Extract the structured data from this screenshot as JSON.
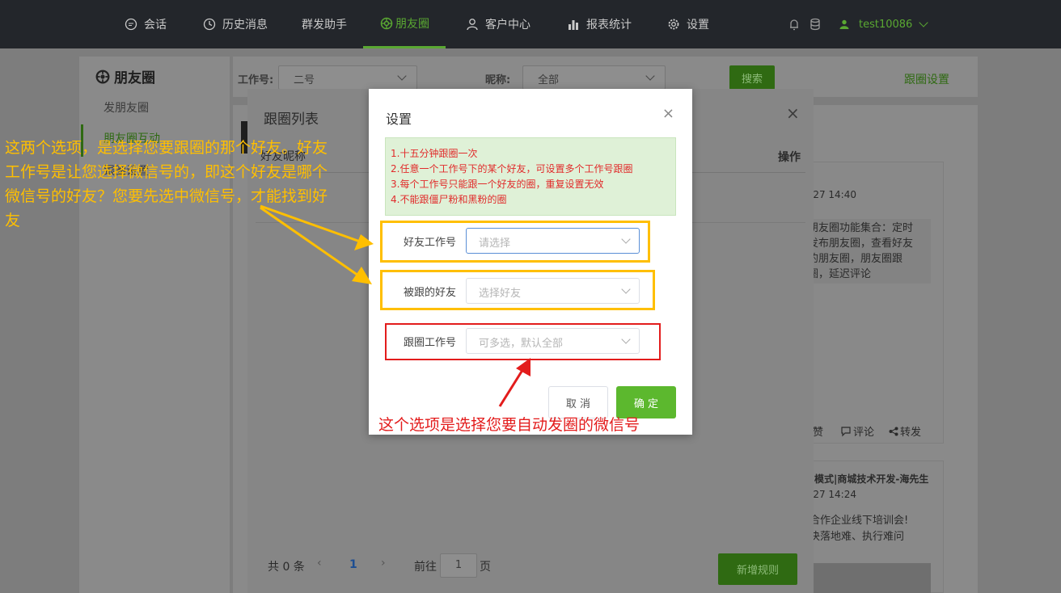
{
  "nav": {
    "tabs": [
      {
        "label": "会话",
        "icon": "chat-icon"
      },
      {
        "label": "历史消息",
        "icon": "clock-icon"
      },
      {
        "label": "群发助手",
        "icon": ""
      },
      {
        "label": "朋友圈",
        "icon": "aperture-icon"
      },
      {
        "label": "客户中心",
        "icon": "user-icon"
      },
      {
        "label": "报表统计",
        "icon": "bar-chart-icon"
      },
      {
        "label": "设置",
        "icon": "gear-icon"
      }
    ],
    "active_tab": "朋友圈",
    "username": "test10086"
  },
  "sidebar": {
    "title": "朋友圈",
    "items": [
      "发朋友圈",
      "朋友圈互动",
      "跟圈设置"
    ]
  },
  "filter": {
    "account_label": "工作号:",
    "account_value": "二号",
    "nickname_label": "昵称:",
    "nickname_value": "全部",
    "search_button": "搜索",
    "follow_settings_link": "跟圈设置"
  },
  "follow_list_dialog": {
    "title": "跟圈列表",
    "col_nickname": "好友昵称",
    "col_action": "操作",
    "pagination": {
      "total": "共 0 条",
      "current_page": "1",
      "goto_label": "前往",
      "goto_value": "1",
      "page_suffix": "页"
    },
    "add_rule_button": "新增规则"
  },
  "posts": [
    {
      "time": "-27 14:40",
      "lines": [
        "朋友圈功能集合：定时",
        "发布朋友圈，查看好友",
        "的朋友圈，朋友圈跟",
        "圈，延迟评论"
      ],
      "actions": [
        "赞",
        "评论",
        "转发"
      ]
    },
    {
      "author": "模式|商城技术开发-海先生",
      "time": "-27 14:24",
      "lines": [
        "合作企业线下培训会!",
        "决落地难、执行难问"
      ]
    }
  ],
  "settings_modal": {
    "title": "设置",
    "notice": [
      "1.十五分钟跟圈一次",
      "2.任意一个工作号下的某个好友，可设置多个工作号跟圈",
      "3.每个工作号只能跟一个好友的圈，重复设置无效",
      "4.不能跟僵尸粉和黑粉的圈"
    ],
    "fields": [
      {
        "label": "好友工作号",
        "placeholder": "请选择"
      },
      {
        "label": "被跟的好友",
        "placeholder": "选择好友"
      },
      {
        "label": "跟圈工作号",
        "placeholder": "可多选，默认全部"
      }
    ],
    "cancel_button": "取 消",
    "confirm_button": "确 定"
  },
  "annotations": {
    "yellow_note": "这两个选项，是选择您要跟圈的那个好友。好友工作号是让您选择微信号的，即这个好友是哪个微信号的好友？您要先选中微信号，才能找到好友",
    "red_note": "这个选项是选择您要自动发圈的微信号",
    "yellow_color": "#ffbf00",
    "red_color": "#e31c1c"
  }
}
